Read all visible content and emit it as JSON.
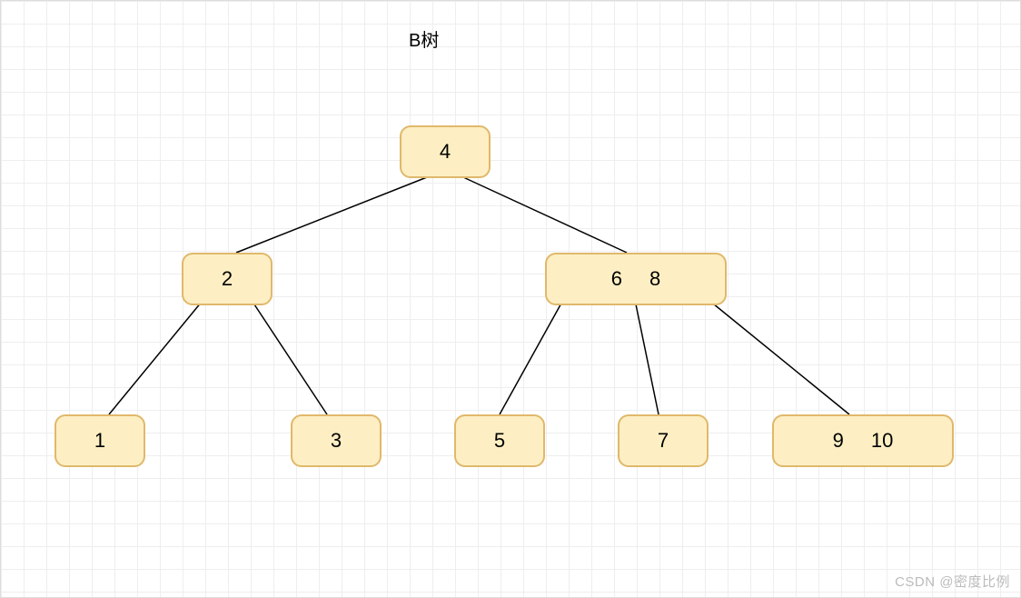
{
  "title": "B树",
  "watermark": "CSDN @密度比例",
  "nodes": {
    "root": {
      "keys": [
        "4"
      ]
    },
    "l1_left": {
      "keys": [
        "2"
      ]
    },
    "l1_right": {
      "keys": [
        "6",
        "8"
      ]
    },
    "leaf_1": {
      "keys": [
        "1"
      ]
    },
    "leaf_3": {
      "keys": [
        "3"
      ]
    },
    "leaf_5": {
      "keys": [
        "5"
      ]
    },
    "leaf_7": {
      "keys": [
        "7"
      ]
    },
    "leaf_910": {
      "keys": [
        "9",
        "10"
      ]
    }
  },
  "chart_data": {
    "type": "tree",
    "title": "B树",
    "description": "B-tree structure diagram",
    "nodes": [
      {
        "id": "root",
        "keys": [
          4
        ],
        "children": [
          "n2",
          "n68"
        ]
      },
      {
        "id": "n2",
        "keys": [
          2
        ],
        "children": [
          "n1",
          "n3"
        ]
      },
      {
        "id": "n68",
        "keys": [
          6,
          8
        ],
        "children": [
          "n5",
          "n7",
          "n910"
        ]
      },
      {
        "id": "n1",
        "keys": [
          1
        ],
        "children": []
      },
      {
        "id": "n3",
        "keys": [
          3
        ],
        "children": []
      },
      {
        "id": "n5",
        "keys": [
          5
        ],
        "children": []
      },
      {
        "id": "n7",
        "keys": [
          7
        ],
        "children": []
      },
      {
        "id": "n910",
        "keys": [
          9,
          10
        ],
        "children": []
      }
    ],
    "edges": [
      {
        "from": "root",
        "to": "n2"
      },
      {
        "from": "root",
        "to": "n68"
      },
      {
        "from": "n2",
        "to": "n1"
      },
      {
        "from": "n2",
        "to": "n3"
      },
      {
        "from": "n68",
        "to": "n5"
      },
      {
        "from": "n68",
        "to": "n7"
      },
      {
        "from": "n68",
        "to": "n910"
      }
    ]
  }
}
